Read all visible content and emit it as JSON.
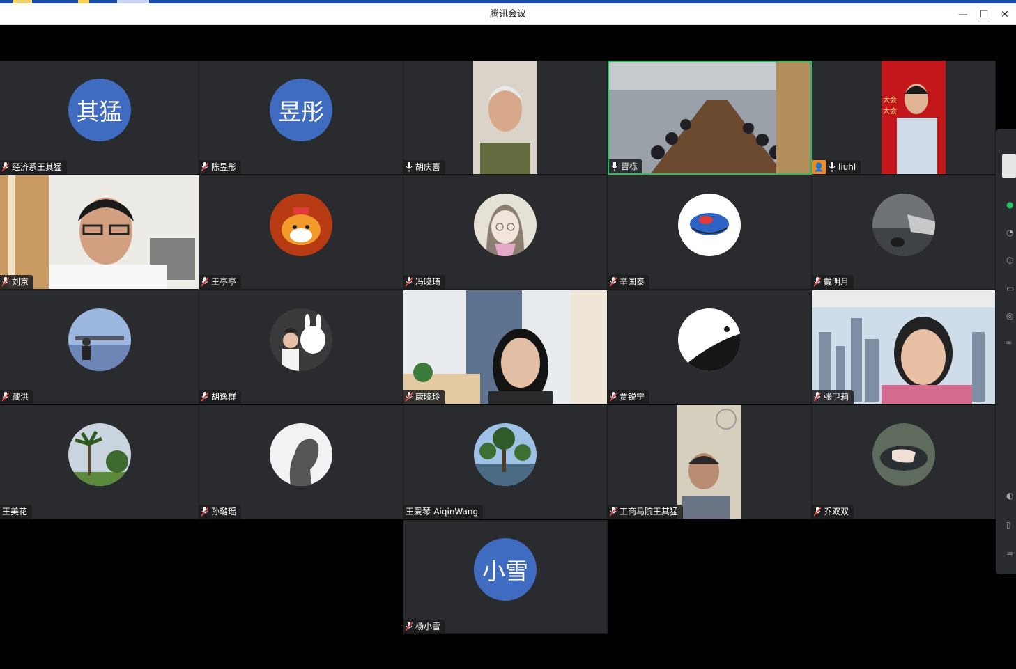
{
  "window": {
    "title": "腾讯会议"
  },
  "controls": {
    "minimize": "—",
    "maximize": "☐",
    "close": "✕"
  },
  "participants": [
    {
      "name": "经济系王其猛",
      "avatar_text": "其猛",
      "mic": "muted"
    },
    {
      "name": "陈昱彤",
      "avatar_text": "昱彤",
      "mic": "muted"
    },
    {
      "name": "胡庆喜",
      "mic": "on",
      "video": "older-man"
    },
    {
      "name": "曹栋",
      "mic": "on",
      "video": "meeting-room",
      "speaking": true
    },
    {
      "name": "liuhl",
      "mic": "on",
      "video": "man-red-banner",
      "host": true,
      "banner_text": "大会\n大会"
    },
    {
      "name": "刘京",
      "mic": "muted",
      "video": "man-glasses"
    },
    {
      "name": "王亭亭",
      "mic": "muted",
      "avatar": "tiger-cartoon"
    },
    {
      "name": "冯晓琦",
      "mic": "muted",
      "avatar": "sketch-girl"
    },
    {
      "name": "辛国泰",
      "mic": "muted",
      "avatar": "sleeping-bird"
    },
    {
      "name": "戴明月",
      "mic": "muted",
      "avatar": "dusk-car"
    },
    {
      "name": "藏洪",
      "mic": "muted",
      "avatar": "street-photo"
    },
    {
      "name": "胡逸群",
      "mic": "muted",
      "avatar": "bunny-girl"
    },
    {
      "name": "康晓玲",
      "mic": "muted",
      "video": "woman-room"
    },
    {
      "name": "贾锐宁",
      "mic": "muted",
      "avatar": "moon-silhouette"
    },
    {
      "name": "张卫莉",
      "mic": "muted",
      "video": "woman-skyline"
    },
    {
      "name": "王美花",
      "mic": "none",
      "avatar": "palm-tree"
    },
    {
      "name": "孙璐瑶",
      "mic": "muted",
      "avatar": "silhouette-profile"
    },
    {
      "name": "王爱琴-AiqinWang",
      "mic": "none",
      "avatar": "lake-trees"
    },
    {
      "name": "工商马院王其猛",
      "mic": "muted",
      "video": "man-fan"
    },
    {
      "name": "乔双双",
      "mic": "muted",
      "avatar": "hand-car"
    },
    {
      "name": "杨小雪",
      "avatar_text": "小雪",
      "mic": "muted"
    }
  ],
  "colors": {
    "speaking_border": "#22c25f",
    "avatar_blue": "#3f6cc0",
    "tile_bg": "#2a2b2e",
    "muted_mic": "#e04545"
  }
}
